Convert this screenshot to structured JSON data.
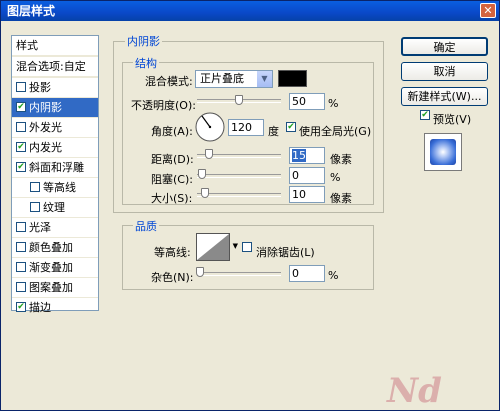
{
  "window": {
    "title": "图层样式",
    "close_glyph": "✕"
  },
  "style_list": {
    "header": "样式",
    "blend_options": "混合选项:自定",
    "items": [
      {
        "label": "投影",
        "checked": false,
        "selected": false,
        "indent": false
      },
      {
        "label": "内阴影",
        "checked": true,
        "selected": true,
        "indent": false
      },
      {
        "label": "外发光",
        "checked": false,
        "selected": false,
        "indent": false
      },
      {
        "label": "内发光",
        "checked": true,
        "selected": false,
        "indent": false
      },
      {
        "label": "斜面和浮雕",
        "checked": true,
        "selected": false,
        "indent": false
      },
      {
        "label": "等高线",
        "checked": false,
        "selected": false,
        "indent": true
      },
      {
        "label": "纹理",
        "checked": false,
        "selected": false,
        "indent": true
      },
      {
        "label": "光泽",
        "checked": false,
        "selected": false,
        "indent": false
      },
      {
        "label": "颜色叠加",
        "checked": false,
        "selected": false,
        "indent": false
      },
      {
        "label": "渐变叠加",
        "checked": false,
        "selected": false,
        "indent": false
      },
      {
        "label": "图案叠加",
        "checked": false,
        "selected": false,
        "indent": false
      },
      {
        "label": "描边",
        "checked": true,
        "selected": false,
        "indent": false
      }
    ]
  },
  "inner_shadow": {
    "title": "内阴影",
    "structure": {
      "title": "结构",
      "blend_mode_label": "混合模式:",
      "blend_mode_value": "正片叠底",
      "swatch_color": "#000000",
      "opacity_label": "不透明度(O):",
      "opacity_value": "50",
      "opacity_unit": "%",
      "opacity_level": 0.5,
      "angle_label": "角度(A):",
      "angle_value": "120",
      "angle_unit": "度",
      "global_light_label": "使用全局光(G)",
      "global_light_checked": true,
      "distance_label": "距离(D):",
      "distance_value": "15",
      "distance_unit": "像素",
      "choke_label": "阻塞(C):",
      "choke_value": "0",
      "choke_unit": "%",
      "size_label": "大小(S):",
      "size_value": "10",
      "size_unit": "像素"
    },
    "quality": {
      "title": "品质",
      "contour_label": "等高线:",
      "antialias_label": "消除锯齿(L)",
      "antialias_checked": false,
      "noise_label": "杂色(N):",
      "noise_value": "0",
      "noise_unit": "%"
    }
  },
  "buttons": {
    "ok": "确定",
    "cancel": "取消",
    "new_style": "新建样式(W)...",
    "preview_label": "预览(V)",
    "preview_checked": true
  },
  "colors": {
    "title_bar": "#0a48c8",
    "selection": "#316ac5",
    "group_label": "#0046d5",
    "preview_swatch": "#3a6fd8"
  },
  "watermark": "Nd"
}
